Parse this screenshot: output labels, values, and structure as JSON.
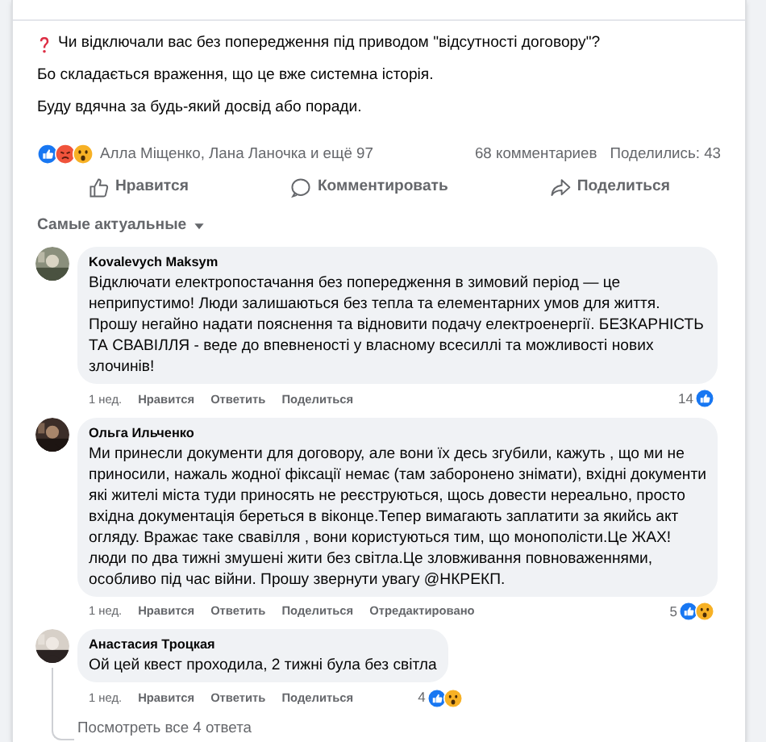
{
  "post": {
    "lines": [
      {
        "kind": "question",
        "text": "Чи відключали вас без попередження під приводом \"відсутності договору\"?"
      },
      {
        "text": "Бо складається враження, що це вже системна історія."
      },
      {
        "text": "Буду вдячна за будь-який досвід або поради."
      }
    ]
  },
  "reactions": {
    "icons": [
      {
        "kind": "like"
      },
      {
        "kind": "angry"
      },
      {
        "kind": "wow"
      }
    ],
    "names": "Алла Міщенко, Лана Ланочка и ещё 97",
    "comments": "68 комментариев",
    "shares": "Поделились: 43"
  },
  "actions": [
    {
      "kind": "like",
      "label": "Нравится"
    },
    {
      "kind": "comment",
      "label": "Комментировать"
    },
    {
      "kind": "share",
      "label": "Поделиться"
    }
  ],
  "sort": {
    "label": "Самые актуальные"
  },
  "comments": [
    {
      "author": "Kovalevych Maksym",
      "text": "Відключати електропостачання без попередження в зимовий період — це неприпустимо! Люди залишаються без тепла та елементарних умов для життя. Прошу негайно надати пояснення та відновити подачу електроенергії. БЕЗКАРНІСТЬ ТА СВАВІЛЛЯ - веде до впевненості у власному всесиллі та можливості нових злочинів!",
      "time": "1 нед.",
      "like": "Нравится",
      "reply": "Ответить",
      "share": "Поделиться",
      "count": "14",
      "reactions": [
        {
          "kind": "like"
        }
      ]
    },
    {
      "author": "Ольга Ильченко",
      "text": "Ми принесли документи для договору, але вони їх десь згубили, кажуть , що ми не приносили, нажаль жодної фіксації немає (там заборонено знімати), вхідні документи які жителі міста туди приносять не реєструються, щось довести нереально, просто вхідна документація береться в віконце.Тепер вимагають заплатити за якийсь акт огляду. Вражає таке свавілля , вони користуються тим, що монополісти.Це ЖАХ! люди по два тижні змушені жити без світла.Це зловживання повноваженнями, особливо під час війни. Прошу звернути увагу @НКРЕКП.",
      "time": "1 нед.",
      "like": "Нравится",
      "reply": "Ответить",
      "share": "Поделиться",
      "edited": "Отредактировано",
      "count": "5",
      "reactions": [
        {
          "kind": "like"
        },
        {
          "kind": "wow"
        }
      ]
    },
    {
      "author": "Анастасия Троцкая",
      "text": "Ой цей квест проходила, 2 тижні була без світла",
      "time": "1 нед.",
      "like": "Нравится",
      "reply": "Ответить",
      "share": "Поделиться",
      "count": "4",
      "reactions": [
        {
          "kind": "like"
        },
        {
          "kind": "wow"
        }
      ],
      "view_replies": "Посмотреть все 4 ответа"
    }
  ]
}
